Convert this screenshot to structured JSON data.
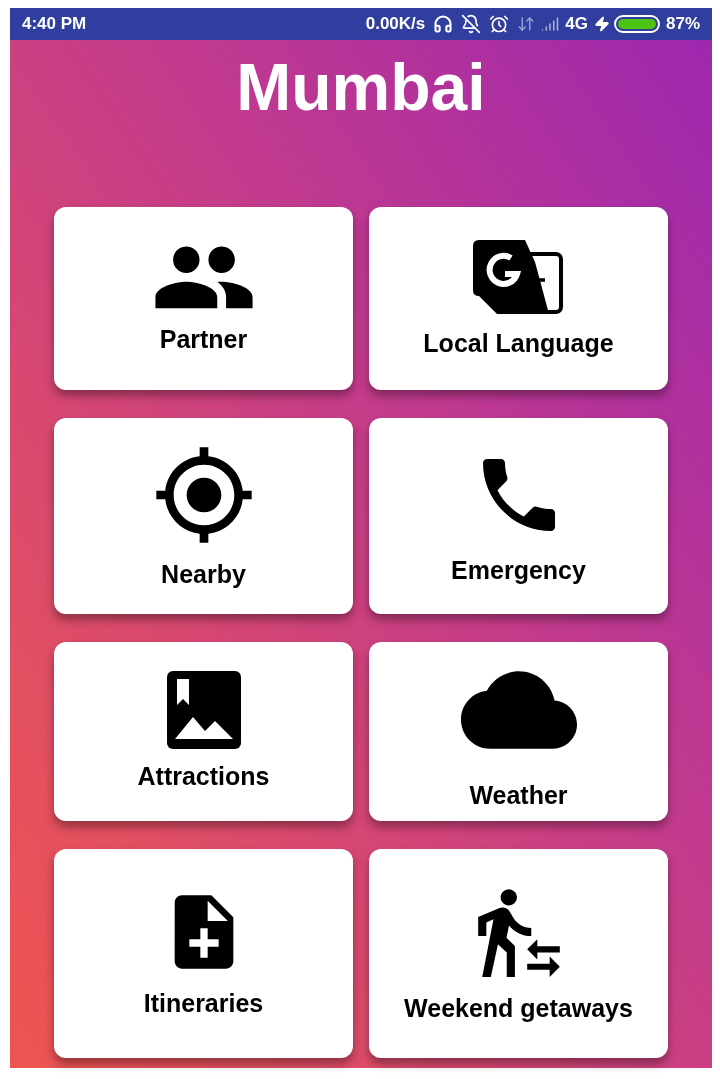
{
  "status_bar": {
    "time": "4:40 PM",
    "network_speed": "0.00K/s",
    "network_type": "4G",
    "battery": "87%"
  },
  "title": "Mumbai",
  "tiles": [
    {
      "label": "Partner",
      "kind": "people"
    },
    {
      "label": "Local Language",
      "kind": "translate"
    },
    {
      "label": "Nearby",
      "kind": "location"
    },
    {
      "label": "Emergency",
      "kind": "phone"
    },
    {
      "label": "Attractions",
      "kind": "photo"
    },
    {
      "label": "Weather",
      "kind": "cloud"
    },
    {
      "label": "Itineraries",
      "kind": "note"
    },
    {
      "label": "Weekend getaways",
      "kind": "walker"
    }
  ]
}
